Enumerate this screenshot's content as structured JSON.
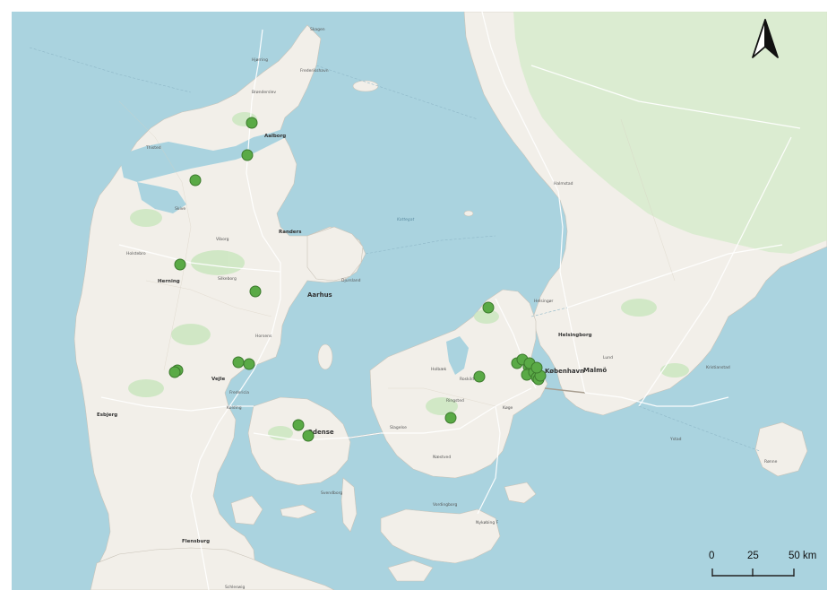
{
  "map": {
    "labels": [
      {
        "text": "Skagen",
        "cls": "lbl"
      },
      {
        "text": "Hjørring",
        "cls": "lbl"
      },
      {
        "text": "Frederikshavn",
        "cls": "lbl"
      },
      {
        "text": "Brønderslev",
        "cls": "lbl"
      },
      {
        "text": "Aalborg",
        "cls": "lbl city"
      },
      {
        "text": "Thisted",
        "cls": "lbl"
      },
      {
        "text": "Skive",
        "cls": "lbl"
      },
      {
        "text": "Viborg",
        "cls": "lbl"
      },
      {
        "text": "Randers",
        "cls": "lbl city"
      },
      {
        "text": "Holstebro",
        "cls": "lbl"
      },
      {
        "text": "Herning",
        "cls": "lbl city"
      },
      {
        "text": "Silkeborg",
        "cls": "lbl"
      },
      {
        "text": "Aarhus",
        "cls": "lbl big"
      },
      {
        "text": "Horsens",
        "cls": "lbl"
      },
      {
        "text": "Vejle",
        "cls": "lbl city"
      },
      {
        "text": "Fredericia",
        "cls": "lbl"
      },
      {
        "text": "Kolding",
        "cls": "lbl"
      },
      {
        "text": "Esbjerg",
        "cls": "lbl city"
      },
      {
        "text": "Odense",
        "cls": "lbl big"
      },
      {
        "text": "Svendborg",
        "cls": "lbl"
      },
      {
        "text": "Flensburg",
        "cls": "lbl city"
      },
      {
        "text": "Schleswig",
        "cls": "lbl"
      },
      {
        "text": "Roskilde",
        "cls": "lbl"
      },
      {
        "text": "København",
        "cls": "lbl big"
      },
      {
        "text": "Køge",
        "cls": "lbl"
      },
      {
        "text": "Helsingør",
        "cls": "lbl"
      },
      {
        "text": "Helsingborg",
        "cls": "lbl city"
      },
      {
        "text": "Malmö",
        "cls": "lbl big"
      },
      {
        "text": "Lund",
        "cls": "lbl"
      },
      {
        "text": "Halmstad",
        "cls": "lbl"
      },
      {
        "text": "Kristianstad",
        "cls": "lbl"
      },
      {
        "text": "Ystad",
        "cls": "lbl"
      },
      {
        "text": "Næstved",
        "cls": "lbl"
      },
      {
        "text": "Slagelse",
        "cls": "lbl"
      },
      {
        "text": "Ringsted",
        "cls": "lbl"
      },
      {
        "text": "Holbæk",
        "cls": "lbl"
      },
      {
        "text": "Kattegat",
        "cls": "lbl sea"
      },
      {
        "text": "Djursland",
        "cls": "lbl"
      },
      {
        "text": "Rønne",
        "cls": "lbl"
      },
      {
        "text": "Nykøbing F",
        "cls": "lbl"
      },
      {
        "text": "Vordingborg",
        "cls": "lbl"
      }
    ],
    "point_color": "#5aaa46",
    "point_stroke": "#3d7a2e",
    "land_color": "#f2efe9",
    "water_color": "#aad3df",
    "forest_color": "#cde7c2",
    "road_color": "#ffffff"
  },
  "north_arrow": {
    "icon": "north-arrow-icon"
  },
  "scale_bar": {
    "ticks": [
      "0",
      "25",
      "50 km"
    ]
  }
}
